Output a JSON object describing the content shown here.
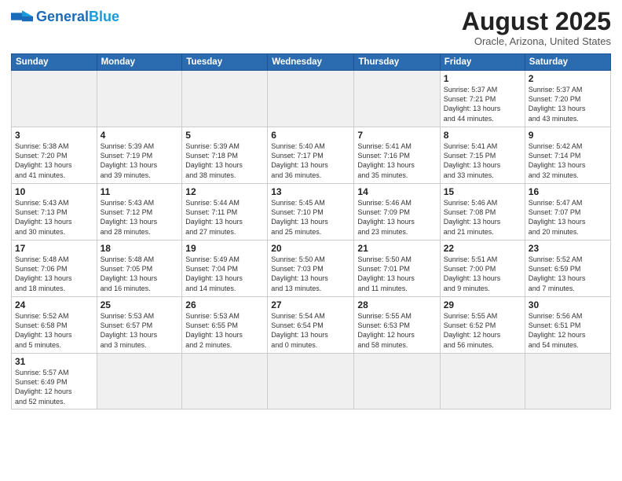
{
  "logo": {
    "text_general": "General",
    "text_blue": "Blue"
  },
  "header": {
    "month_year": "August 2025",
    "location": "Oracle, Arizona, United States"
  },
  "weekdays": [
    "Sunday",
    "Monday",
    "Tuesday",
    "Wednesday",
    "Thursday",
    "Friday",
    "Saturday"
  ],
  "weeks": [
    [
      {
        "day": "",
        "info": ""
      },
      {
        "day": "",
        "info": ""
      },
      {
        "day": "",
        "info": ""
      },
      {
        "day": "",
        "info": ""
      },
      {
        "day": "",
        "info": ""
      },
      {
        "day": "1",
        "info": "Sunrise: 5:37 AM\nSunset: 7:21 PM\nDaylight: 13 hours\nand 44 minutes."
      },
      {
        "day": "2",
        "info": "Sunrise: 5:37 AM\nSunset: 7:20 PM\nDaylight: 13 hours\nand 43 minutes."
      }
    ],
    [
      {
        "day": "3",
        "info": "Sunrise: 5:38 AM\nSunset: 7:20 PM\nDaylight: 13 hours\nand 41 minutes."
      },
      {
        "day": "4",
        "info": "Sunrise: 5:39 AM\nSunset: 7:19 PM\nDaylight: 13 hours\nand 39 minutes."
      },
      {
        "day": "5",
        "info": "Sunrise: 5:39 AM\nSunset: 7:18 PM\nDaylight: 13 hours\nand 38 minutes."
      },
      {
        "day": "6",
        "info": "Sunrise: 5:40 AM\nSunset: 7:17 PM\nDaylight: 13 hours\nand 36 minutes."
      },
      {
        "day": "7",
        "info": "Sunrise: 5:41 AM\nSunset: 7:16 PM\nDaylight: 13 hours\nand 35 minutes."
      },
      {
        "day": "8",
        "info": "Sunrise: 5:41 AM\nSunset: 7:15 PM\nDaylight: 13 hours\nand 33 minutes."
      },
      {
        "day": "9",
        "info": "Sunrise: 5:42 AM\nSunset: 7:14 PM\nDaylight: 13 hours\nand 32 minutes."
      }
    ],
    [
      {
        "day": "10",
        "info": "Sunrise: 5:43 AM\nSunset: 7:13 PM\nDaylight: 13 hours\nand 30 minutes."
      },
      {
        "day": "11",
        "info": "Sunrise: 5:43 AM\nSunset: 7:12 PM\nDaylight: 13 hours\nand 28 minutes."
      },
      {
        "day": "12",
        "info": "Sunrise: 5:44 AM\nSunset: 7:11 PM\nDaylight: 13 hours\nand 27 minutes."
      },
      {
        "day": "13",
        "info": "Sunrise: 5:45 AM\nSunset: 7:10 PM\nDaylight: 13 hours\nand 25 minutes."
      },
      {
        "day": "14",
        "info": "Sunrise: 5:46 AM\nSunset: 7:09 PM\nDaylight: 13 hours\nand 23 minutes."
      },
      {
        "day": "15",
        "info": "Sunrise: 5:46 AM\nSunset: 7:08 PM\nDaylight: 13 hours\nand 21 minutes."
      },
      {
        "day": "16",
        "info": "Sunrise: 5:47 AM\nSunset: 7:07 PM\nDaylight: 13 hours\nand 20 minutes."
      }
    ],
    [
      {
        "day": "17",
        "info": "Sunrise: 5:48 AM\nSunset: 7:06 PM\nDaylight: 13 hours\nand 18 minutes."
      },
      {
        "day": "18",
        "info": "Sunrise: 5:48 AM\nSunset: 7:05 PM\nDaylight: 13 hours\nand 16 minutes."
      },
      {
        "day": "19",
        "info": "Sunrise: 5:49 AM\nSunset: 7:04 PM\nDaylight: 13 hours\nand 14 minutes."
      },
      {
        "day": "20",
        "info": "Sunrise: 5:50 AM\nSunset: 7:03 PM\nDaylight: 13 hours\nand 13 minutes."
      },
      {
        "day": "21",
        "info": "Sunrise: 5:50 AM\nSunset: 7:01 PM\nDaylight: 13 hours\nand 11 minutes."
      },
      {
        "day": "22",
        "info": "Sunrise: 5:51 AM\nSunset: 7:00 PM\nDaylight: 13 hours\nand 9 minutes."
      },
      {
        "day": "23",
        "info": "Sunrise: 5:52 AM\nSunset: 6:59 PM\nDaylight: 13 hours\nand 7 minutes."
      }
    ],
    [
      {
        "day": "24",
        "info": "Sunrise: 5:52 AM\nSunset: 6:58 PM\nDaylight: 13 hours\nand 5 minutes."
      },
      {
        "day": "25",
        "info": "Sunrise: 5:53 AM\nSunset: 6:57 PM\nDaylight: 13 hours\nand 3 minutes."
      },
      {
        "day": "26",
        "info": "Sunrise: 5:53 AM\nSunset: 6:55 PM\nDaylight: 13 hours\nand 2 minutes."
      },
      {
        "day": "27",
        "info": "Sunrise: 5:54 AM\nSunset: 6:54 PM\nDaylight: 13 hours\nand 0 minutes."
      },
      {
        "day": "28",
        "info": "Sunrise: 5:55 AM\nSunset: 6:53 PM\nDaylight: 12 hours\nand 58 minutes."
      },
      {
        "day": "29",
        "info": "Sunrise: 5:55 AM\nSunset: 6:52 PM\nDaylight: 12 hours\nand 56 minutes."
      },
      {
        "day": "30",
        "info": "Sunrise: 5:56 AM\nSunset: 6:51 PM\nDaylight: 12 hours\nand 54 minutes."
      }
    ],
    [
      {
        "day": "31",
        "info": "Sunrise: 5:57 AM\nSunset: 6:49 PM\nDaylight: 12 hours\nand 52 minutes."
      },
      {
        "day": "",
        "info": ""
      },
      {
        "day": "",
        "info": ""
      },
      {
        "day": "",
        "info": ""
      },
      {
        "day": "",
        "info": ""
      },
      {
        "day": "",
        "info": ""
      },
      {
        "day": "",
        "info": ""
      }
    ]
  ]
}
